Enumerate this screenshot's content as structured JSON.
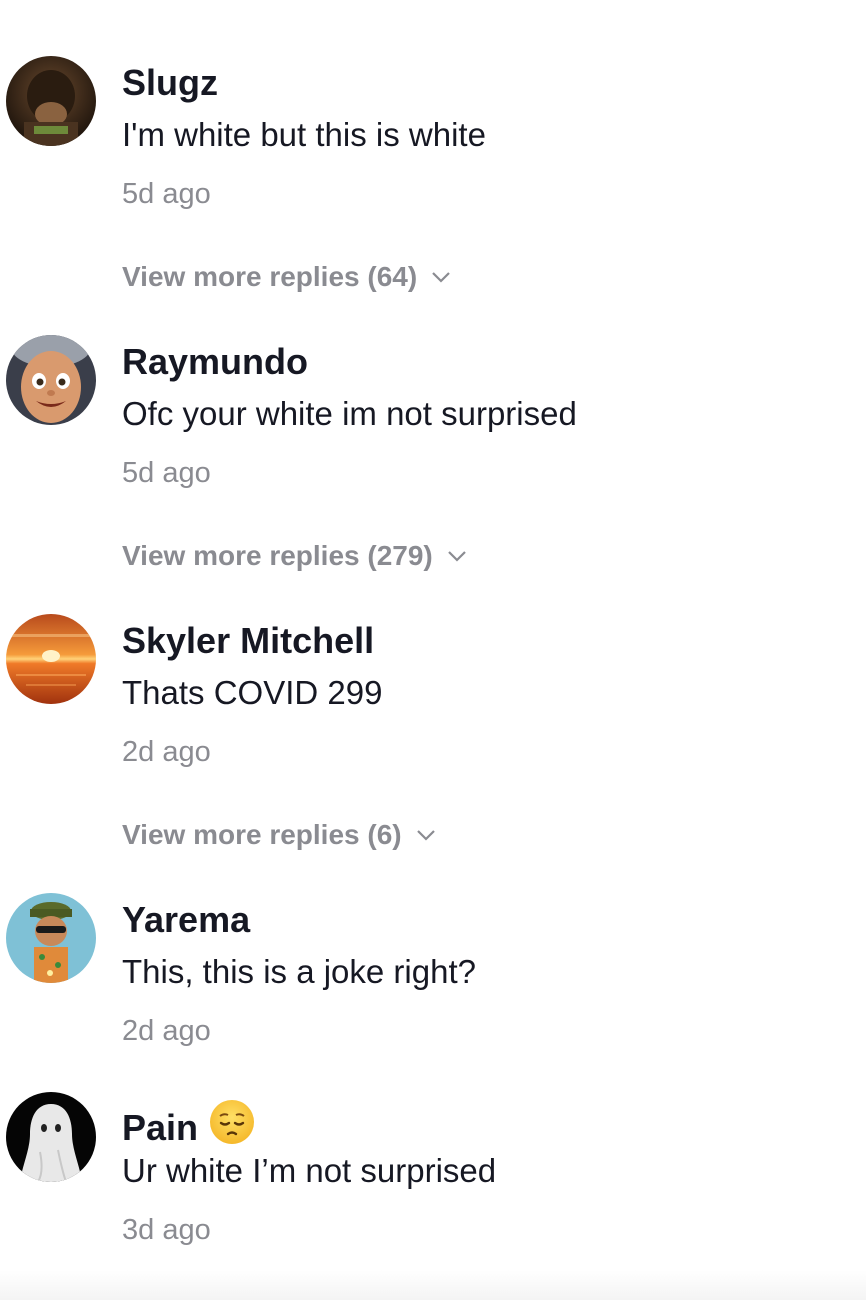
{
  "comments": [
    {
      "username": "Slugz",
      "text": "I'm white but this is white",
      "time": "5d ago",
      "replies_label": "View more replies (64)",
      "avatar_icon": "dark-portrait-avatar"
    },
    {
      "username": "Raymundo",
      "text": "Ofc your white im not surprised",
      "time": "5d ago",
      "replies_label": "View more replies (279)",
      "avatar_icon": "cartoon-face-avatar"
    },
    {
      "username": "Skyler Mitchell",
      "text": "Thats COVID 299",
      "time": "2d ago",
      "replies_label": "View more replies (6)",
      "avatar_icon": "sunset-avatar"
    },
    {
      "username": "Yarema",
      "text": "This, this is a joke right?",
      "time": "2d ago",
      "avatar_icon": "cartoon-character-avatar"
    },
    {
      "username": "Pain",
      "emoji": "pensive-face-emoji",
      "text": "Ur white I’m not surprised",
      "time": "3d ago",
      "avatar_icon": "ghost-avatar"
    }
  ],
  "colors": {
    "username": "#161823",
    "text": "#161823",
    "muted": "#8a8b91",
    "background": "#ffffff"
  }
}
